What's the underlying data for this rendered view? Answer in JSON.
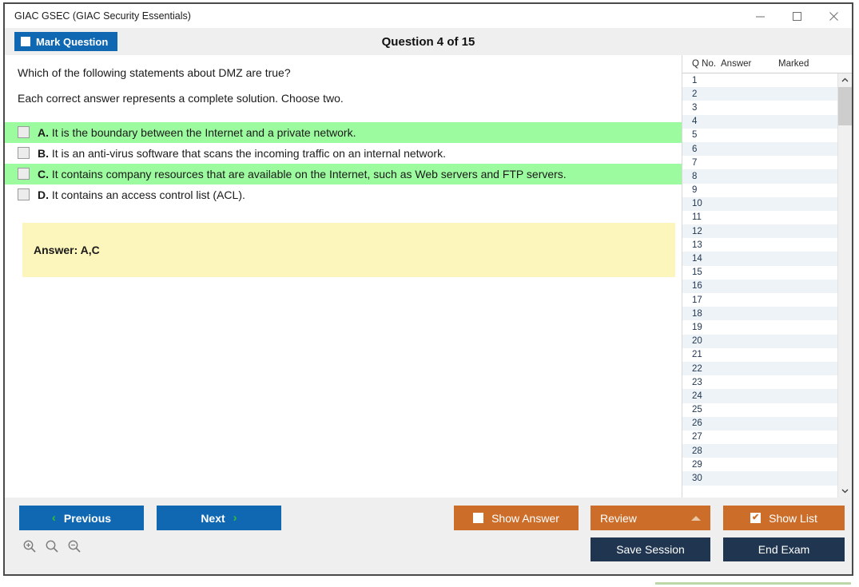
{
  "window": {
    "title": "GIAC GSEC (GIAC Security Essentials)",
    "minimize_icon": "minimize-icon",
    "maximize_icon": "maximize-icon",
    "close_icon": "close-icon"
  },
  "header": {
    "mark_question_label": "Mark Question",
    "question_title": "Question 4 of 15"
  },
  "question": {
    "stem": "Which of the following statements about DMZ are true?",
    "instruction": "Each correct answer represents a complete solution. Choose two.",
    "options": [
      {
        "letter": "A.",
        "text": "It is the boundary between the Internet and a private network.",
        "correct": true,
        "checked": false
      },
      {
        "letter": "B.",
        "text": "It is an anti-virus software that scans the incoming traffic on an internal network.",
        "correct": false,
        "checked": false
      },
      {
        "letter": "C.",
        "text": "It contains company resources that are available on the Internet, such as Web servers and FTP servers.",
        "correct": true,
        "checked": false
      },
      {
        "letter": "D.",
        "text": "It contains an access control list (ACL).",
        "correct": false,
        "checked": false
      }
    ],
    "answer_label": "Answer: A,C"
  },
  "question_list": {
    "columns": [
      "Q No.",
      "Answer",
      "Marked"
    ],
    "rows": [
      {
        "no": "1",
        "answer": "",
        "marked": ""
      },
      {
        "no": "2",
        "answer": "",
        "marked": ""
      },
      {
        "no": "3",
        "answer": "",
        "marked": ""
      },
      {
        "no": "4",
        "answer": "",
        "marked": ""
      },
      {
        "no": "5",
        "answer": "",
        "marked": ""
      },
      {
        "no": "6",
        "answer": "",
        "marked": ""
      },
      {
        "no": "7",
        "answer": "",
        "marked": ""
      },
      {
        "no": "8",
        "answer": "",
        "marked": ""
      },
      {
        "no": "9",
        "answer": "",
        "marked": ""
      },
      {
        "no": "10",
        "answer": "",
        "marked": ""
      },
      {
        "no": "11",
        "answer": "",
        "marked": ""
      },
      {
        "no": "12",
        "answer": "",
        "marked": ""
      },
      {
        "no": "13",
        "answer": "",
        "marked": ""
      },
      {
        "no": "14",
        "answer": "",
        "marked": ""
      },
      {
        "no": "15",
        "answer": "",
        "marked": ""
      },
      {
        "no": "16",
        "answer": "",
        "marked": ""
      },
      {
        "no": "17",
        "answer": "",
        "marked": ""
      },
      {
        "no": "18",
        "answer": "",
        "marked": ""
      },
      {
        "no": "19",
        "answer": "",
        "marked": ""
      },
      {
        "no": "20",
        "answer": "",
        "marked": ""
      },
      {
        "no": "21",
        "answer": "",
        "marked": ""
      },
      {
        "no": "22",
        "answer": "",
        "marked": ""
      },
      {
        "no": "23",
        "answer": "",
        "marked": ""
      },
      {
        "no": "24",
        "answer": "",
        "marked": ""
      },
      {
        "no": "25",
        "answer": "",
        "marked": ""
      },
      {
        "no": "26",
        "answer": "",
        "marked": ""
      },
      {
        "no": "27",
        "answer": "",
        "marked": ""
      },
      {
        "no": "28",
        "answer": "",
        "marked": ""
      },
      {
        "no": "29",
        "answer": "",
        "marked": ""
      },
      {
        "no": "30",
        "answer": "",
        "marked": ""
      }
    ],
    "scroll_up_icon": "chevron-up-icon",
    "scroll_down_icon": "chevron-down-icon"
  },
  "footer": {
    "previous_label": "Previous",
    "next_label": "Next",
    "show_answer_label": "Show Answer",
    "show_answer_checked": false,
    "review_label": "Review",
    "show_list_label": "Show List",
    "show_list_checked": true,
    "show_list_check_glyph": "✔",
    "save_session_label": "Save Session",
    "end_exam_label": "End Exam",
    "zoom_in_icon": "zoom-in-icon",
    "zoom_reset_icon": "zoom-icon",
    "zoom_out_icon": "zoom-out-icon"
  },
  "colors": {
    "accent_blue": "#1068b3",
    "accent_orange": "#cc6e2a",
    "navy": "#1f3550",
    "correct_green": "#9dfb9f",
    "answer_yellow": "#fcf5bc",
    "chevron_green": "#2fc12f"
  }
}
